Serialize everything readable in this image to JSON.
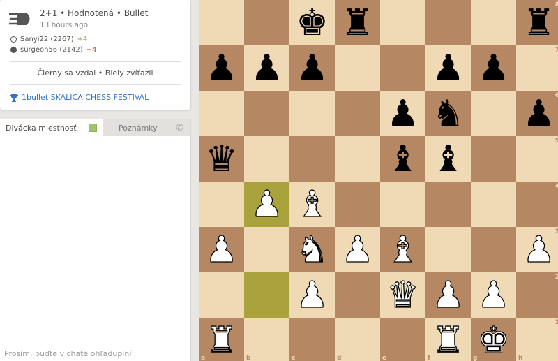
{
  "game": {
    "title": "2+1 • Hodnotená • Bullet",
    "time": "13 hours ago",
    "white_player": "Sanyi22 (2267)",
    "white_diff": "+4",
    "black_player": "surgeon56 (2142)",
    "black_diff": "−4",
    "result": "Čierny sa vzdal • Biely zvíťazil",
    "tournament": "1bullet SKALICA CHESS FESTIVAL",
    "icons": {
      "speed": "bullet-icon",
      "tournament": "trophy-icon"
    }
  },
  "chat": {
    "tab_room": "Divácka miestnosť",
    "tab_notes": "Poznámky",
    "input_placeholder": "Prosím, buďte v chate ohľaduplní!",
    "toggle_color": "#9ec36b"
  },
  "board": {
    "colors": {
      "light": "#f0d9b5",
      "dark": "#b58863",
      "highlight_light": "#cdd26a",
      "highlight_dark": "#aaa23a"
    },
    "files": [
      "a",
      "b",
      "c",
      "d",
      "e",
      "f",
      "g",
      "h"
    ],
    "ranks": [
      "8",
      "7",
      "6",
      "5",
      "4",
      "3",
      "2",
      "1"
    ],
    "highlighted": [
      "b2",
      "b4"
    ],
    "position": {
      "c8": "bk",
      "d8": "br",
      "h8": "br",
      "a7": "bp",
      "b7": "bp",
      "c7": "bp",
      "f7": "bp",
      "g7": "bp",
      "e6": "bp",
      "f6": "bn",
      "h6": "bp",
      "a5": "bq",
      "e5": "bb",
      "f5": "bb",
      "b4": "wp",
      "c4": "wb",
      "a3": "wp",
      "c3": "wn",
      "d3": "wp",
      "e3": "wb",
      "h3": "wp",
      "c2": "wp",
      "e2": "wq",
      "f2": "wp",
      "g2": "wp",
      "a1": "wr",
      "f1": "wr",
      "g1": "wk"
    }
  }
}
